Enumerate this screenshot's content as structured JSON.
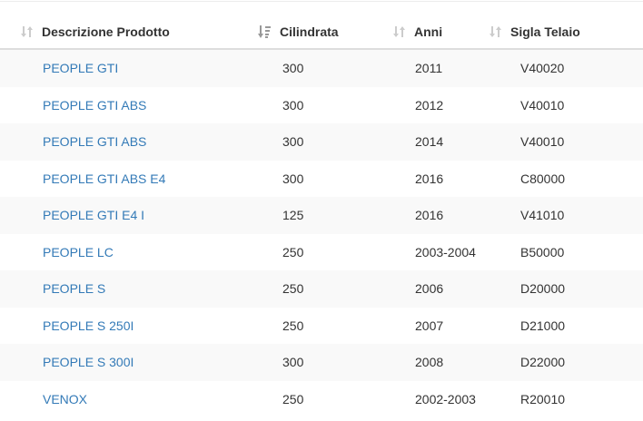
{
  "table": {
    "headers": {
      "descrizione": "Descrizione Prodotto",
      "cilindrata": "Cilindrata",
      "anni": "Anni",
      "sigla": "Sigla Telaio"
    },
    "sorted_column": "cilindrata",
    "rows": [
      {
        "descrizione": "PEOPLE GTI",
        "cilindrata": "300",
        "anni": "2011",
        "sigla": "V40020"
      },
      {
        "descrizione": "PEOPLE GTI ABS",
        "cilindrata": "300",
        "anni": "2012",
        "sigla": "V40010"
      },
      {
        "descrizione": "PEOPLE GTI ABS",
        "cilindrata": "300",
        "anni": "2014",
        "sigla": "V40010"
      },
      {
        "descrizione": "PEOPLE GTI ABS E4",
        "cilindrata": "300",
        "anni": "2016",
        "sigla": "C80000"
      },
      {
        "descrizione": "PEOPLE GTI E4 I",
        "cilindrata": "125",
        "anni": "2016",
        "sigla": "V41010"
      },
      {
        "descrizione": "PEOPLE LC",
        "cilindrata": "250",
        "anni": "2003-2004",
        "sigla": "B50000"
      },
      {
        "descrizione": "PEOPLE S",
        "cilindrata": "250",
        "anni": "2006",
        "sigla": "D20000"
      },
      {
        "descrizione": "PEOPLE S 250I",
        "cilindrata": "250",
        "anni": "2007",
        "sigla": "D21000"
      },
      {
        "descrizione": "PEOPLE S 300I",
        "cilindrata": "300",
        "anni": "2008",
        "sigla": "D22000"
      },
      {
        "descrizione": "VENOX",
        "cilindrata": "250",
        "anni": "2002-2003",
        "sigla": "R20010"
      }
    ]
  },
  "colors": {
    "link": "#337ab7",
    "text": "#333333",
    "stripe": "#f9f9f9",
    "sort_icon_inactive": "#cccccc",
    "sort_icon_active": "#999999"
  },
  "icons": {
    "unsorted": "sort-both-icon",
    "sorted_desc": "sort-amount-desc-icon"
  }
}
